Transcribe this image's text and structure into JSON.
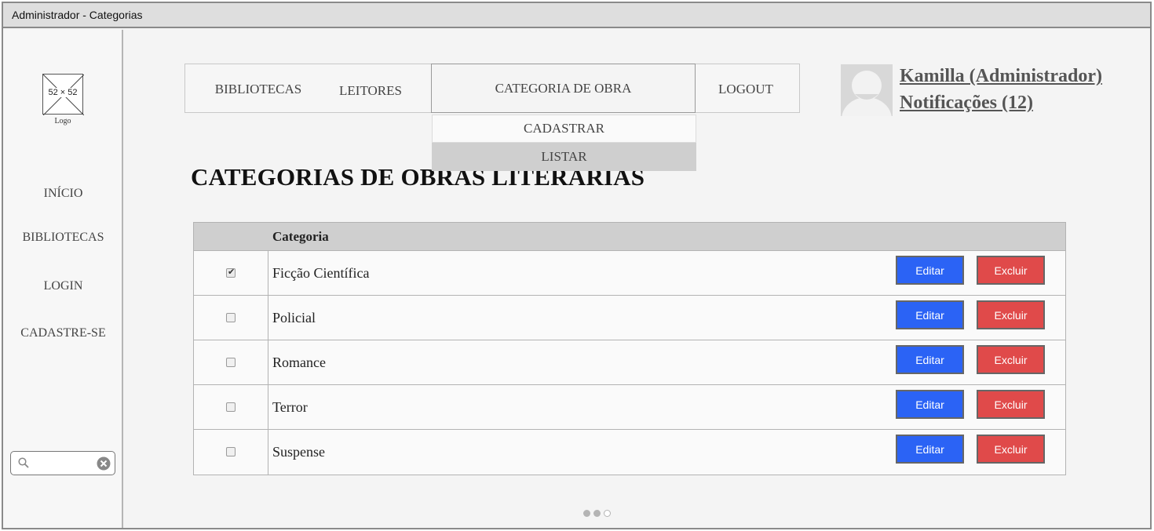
{
  "window": {
    "title": "Administrador - Categorias"
  },
  "sidebar": {
    "logo_size": "52 × 52",
    "logo_caption": "Logo",
    "items": [
      {
        "label": "INÍCIO"
      },
      {
        "label": "BIBLIOTECAS"
      },
      {
        "label": "LOGIN"
      },
      {
        "label": "CADASTRE-SE"
      }
    ],
    "search": {
      "value": "",
      "placeholder": ""
    }
  },
  "nav": {
    "items": [
      {
        "label": "BIBLIOTECAS"
      },
      {
        "label": "LEITORES"
      },
      {
        "label": "CATEGORIA DE OBRA"
      },
      {
        "label": "LOGOUT"
      }
    ],
    "dropdown": [
      {
        "label": "CADASTRAR"
      },
      {
        "label": "LISTAR"
      }
    ]
  },
  "user": {
    "name": "Kamilla (Administrador)",
    "notifications": "Notificações (12)"
  },
  "page": {
    "title": "CATEGORIAS DE OBRAS LITERARIAS"
  },
  "table": {
    "header": {
      "category": "Categoria"
    },
    "rows": [
      {
        "checked": true,
        "name": "Ficção Científica",
        "edit": "Editar",
        "delete": "Excluir"
      },
      {
        "checked": false,
        "name": "Policial",
        "edit": "Editar",
        "delete": "Excluir"
      },
      {
        "checked": false,
        "name": "Romance",
        "edit": "Editar",
        "delete": "Excluir"
      },
      {
        "checked": false,
        "name": "Terror",
        "edit": "Editar",
        "delete": "Excluir"
      },
      {
        "checked": false,
        "name": "Suspense",
        "edit": "Editar",
        "delete": "Excluir"
      }
    ]
  },
  "pagination": {
    "pages": 3,
    "current": 2
  },
  "colors": {
    "edit_button": "#2b63f5",
    "delete_button": "#e04a4a",
    "dropdown_active": "#cfcfcf"
  }
}
